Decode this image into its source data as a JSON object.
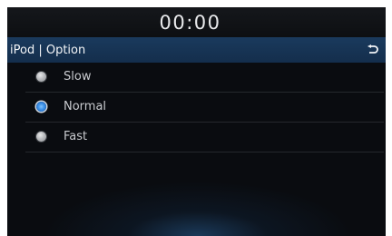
{
  "status_bar": {
    "clock": "00:00"
  },
  "title_bar": {
    "title": "iPod | Option",
    "back_icon": "back-arrow-icon"
  },
  "options": [
    {
      "label": "Slow",
      "selected": false
    },
    {
      "label": "Normal",
      "selected": true
    },
    {
      "label": "Fast",
      "selected": false
    }
  ],
  "colors": {
    "title_bar_bg": "#173452",
    "selected_radio": "#3a8ee6",
    "screen_bg": "#0a0c10"
  }
}
